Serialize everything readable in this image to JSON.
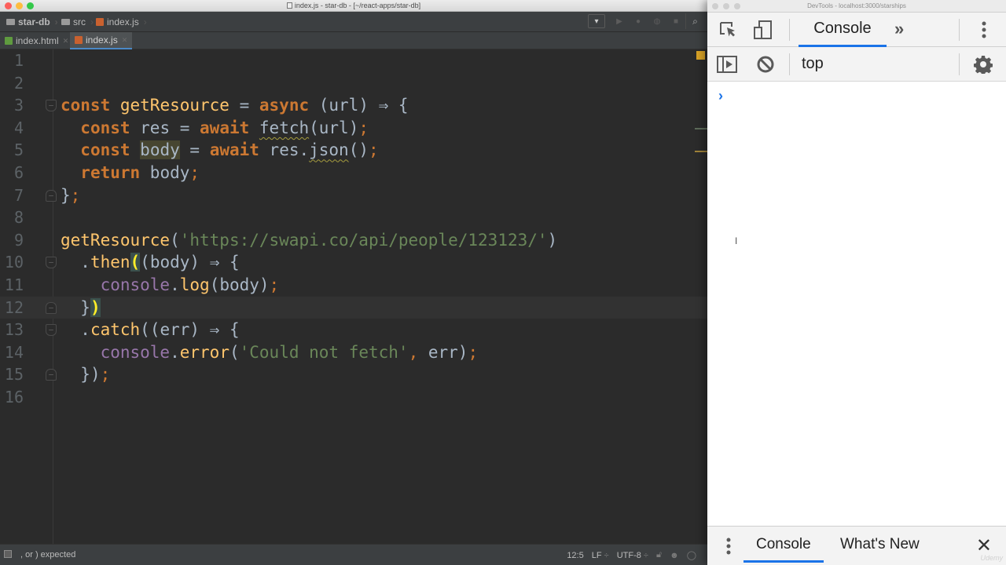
{
  "ide": {
    "window_title": "index.js - star-db - [~/react-apps/star-db]",
    "breadcrumbs": [
      {
        "label": "star-db",
        "icon": "folder-icon"
      },
      {
        "label": "src",
        "icon": "folder-icon"
      },
      {
        "label": "index.js",
        "icon": "js-file-icon"
      }
    ],
    "toolbar": {
      "run_config_dropdown": "▾",
      "run": "run-icon",
      "debug": "debug-icon",
      "coverage": "coverage-icon",
      "stop": "stop-icon",
      "search": "search-icon"
    },
    "tabs": [
      {
        "label": "index.html",
        "icon": "html-file-icon",
        "active": false
      },
      {
        "label": "index.js",
        "icon": "js-file-icon",
        "active": true
      }
    ],
    "editor": {
      "current_line": 12,
      "lines": [
        {
          "n": "1",
          "text": ""
        },
        {
          "n": "2",
          "text": ""
        },
        {
          "n": "3",
          "text": "const getResource = async (url) ⇒ {"
        },
        {
          "n": "4",
          "text": "  const res = await fetch(url);"
        },
        {
          "n": "5",
          "text": "  const body = await res.json();"
        },
        {
          "n": "6",
          "text": "  return body;"
        },
        {
          "n": "7",
          "text": "};"
        },
        {
          "n": "8",
          "text": ""
        },
        {
          "n": "9",
          "text": "getResource('https://swapi.co/api/people/123123/')"
        },
        {
          "n": "10",
          "text": "  .then((body) ⇒ {"
        },
        {
          "n": "11",
          "text": "    console.log(body);"
        },
        {
          "n": "12",
          "text": "  })"
        },
        {
          "n": "13",
          "text": "  .catch((err) ⇒ {"
        },
        {
          "n": "14",
          "text": "    console.error('Could not fetch', err);"
        },
        {
          "n": "15",
          "text": "  });"
        },
        {
          "n": "16",
          "text": ""
        }
      ],
      "tokens": {
        "const": "const",
        "getResource": "getResource",
        "eq": " = ",
        "async": "async",
        "url_params": " (url) ⇒ {",
        "res": " res",
        "await": "await",
        "fetch": "fetch",
        "fetch_args": "(url)",
        "semi": ";",
        "body": "body",
        "res_dot": " res.",
        "json": "json",
        "json_args": "()",
        "return": "return",
        "body_sp": " body",
        "close_brace": "}",
        "open_paren": "(",
        "url_string": "'https://swapi.co/api/people/123123/'",
        "close_paren": ")",
        "dot": ".",
        "then": "then",
        "body_params": "(body) ⇒ {",
        "console": "console",
        "log": "log",
        "body_arg": "(body)",
        "catch": "catch",
        "err_params": "(err) ⇒ {",
        "error": "error",
        "fetch_msg": "'Could not fetch'",
        "comma": ",",
        "err_arg": " err)",
        "close_call": "})"
      }
    },
    "status": {
      "message": ", or ) expected",
      "position": "12:5",
      "line_separator": "LF",
      "encoding": "UTF-8",
      "lock_icon": "lock-icon",
      "inspector_icon": "hector-icon",
      "event_icon": "event-log-icon"
    }
  },
  "devtools": {
    "window_title": "DevTools - localhost:3000/starships",
    "tabs": {
      "active": "Console",
      "more": "»"
    },
    "context": "top",
    "prompt": "›",
    "drawer": {
      "tabs": [
        "Console",
        "What's New"
      ],
      "active": "Console",
      "close": "✕"
    }
  },
  "watermark": "Udemy"
}
